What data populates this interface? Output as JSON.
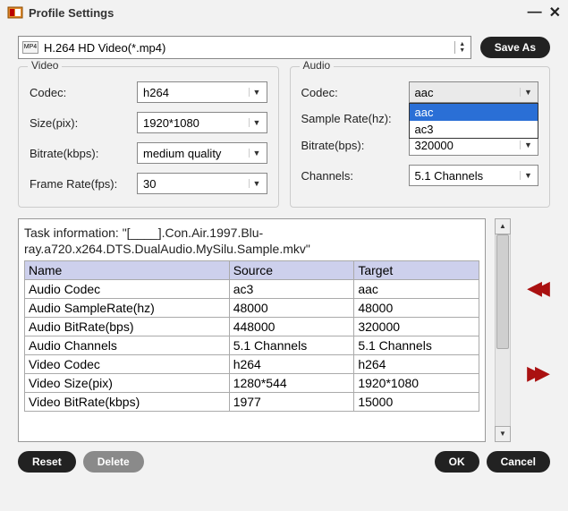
{
  "title": "Profile Settings",
  "profile_selected": "H.264 HD Video(*.mp4)",
  "buttons": {
    "save_as": "Save As",
    "reset": "Reset",
    "delete": "Delete",
    "ok": "OK",
    "cancel": "Cancel"
  },
  "video": {
    "title": "Video",
    "codec_label": "Codec:",
    "codec": "h264",
    "size_label": "Size(pix):",
    "size": "1920*1080",
    "bitrate_label": "Bitrate(kbps):",
    "bitrate": "medium quality",
    "framerate_label": "Frame Rate(fps):",
    "framerate": "30"
  },
  "audio": {
    "title": "Audio",
    "codec_label": "Codec:",
    "codec": "aac",
    "codec_options": [
      "aac",
      "ac3"
    ],
    "samplerate_label": "Sample Rate(hz):",
    "samplerate": "",
    "bitrate_label": "Bitrate(bps):",
    "bitrate": "320000",
    "channels_label": "Channels:",
    "channels": "5.1 Channels"
  },
  "task_info": "Task information: \"[____].Con.Air.1997.Blu-ray.a720.x264.DTS.DualAudio.MySilu.Sample.mkv\"",
  "table": {
    "headers": [
      "Name",
      "Source",
      "Target"
    ],
    "rows": [
      [
        "Audio Codec",
        "ac3",
        "aac"
      ],
      [
        "Audio SampleRate(hz)",
        "48000",
        "48000"
      ],
      [
        "Audio BitRate(bps)",
        "448000",
        "320000"
      ],
      [
        "Audio Channels",
        "5.1 Channels",
        "5.1 Channels"
      ],
      [
        "Video Codec",
        "h264",
        "h264"
      ],
      [
        "Video Size(pix)",
        "1280*544",
        "1920*1080"
      ],
      [
        "Video BitRate(kbps)",
        "1977",
        "15000"
      ]
    ]
  }
}
